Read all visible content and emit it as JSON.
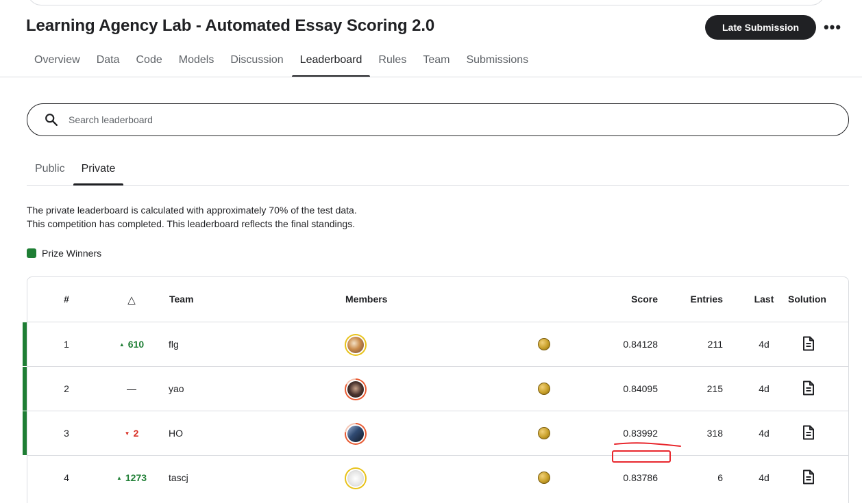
{
  "header": {
    "title": "Learning Agency Lab - Automated Essay Scoring 2.0",
    "late_submission_label": "Late Submission",
    "more_label": "•••"
  },
  "nav": {
    "tabs": [
      {
        "label": "Overview",
        "active": false
      },
      {
        "label": "Data",
        "active": false
      },
      {
        "label": "Code",
        "active": false
      },
      {
        "label": "Models",
        "active": false
      },
      {
        "label": "Discussion",
        "active": false
      },
      {
        "label": "Leaderboard",
        "active": true
      },
      {
        "label": "Rules",
        "active": false
      },
      {
        "label": "Team",
        "active": false
      },
      {
        "label": "Submissions",
        "active": false
      }
    ]
  },
  "search": {
    "placeholder": "Search leaderboard",
    "value": ""
  },
  "subtabs": [
    {
      "label": "Public",
      "active": false
    },
    {
      "label": "Private",
      "active": true
    }
  ],
  "info": {
    "line1": "The private leaderboard is calculated with approximately 70% of the test data.",
    "line2": "This competition has completed. This leaderboard reflects the final standings."
  },
  "legend": {
    "label": "Prize Winners",
    "color": "#1e7e34"
  },
  "table": {
    "headers": {
      "rank": "#",
      "delta": "△",
      "team": "Team",
      "members": "Members",
      "score": "Score",
      "entries": "Entries",
      "last": "Last",
      "solution": "Solution"
    },
    "rows": [
      {
        "rank": "1",
        "delta": "610",
        "delta_dir": "up",
        "team": "flg",
        "avatar_ring": "#e8c21a",
        "avatar_fill": "#c9a27a",
        "score": "0.84128",
        "entries": "211",
        "last": "4d",
        "prize_winner": true
      },
      {
        "rank": "2",
        "delta": "—",
        "delta_dir": "none",
        "team": "yao",
        "avatar_ring": "#e85a32",
        "avatar_fill": "#3a2c2a",
        "score": "0.84095",
        "entries": "215",
        "last": "4d",
        "prize_winner": true
      },
      {
        "rank": "3",
        "delta": "2",
        "delta_dir": "down",
        "team": "HO",
        "avatar_ring": "#e85a32",
        "avatar_fill": "#2f4a72",
        "score": "0.83992",
        "entries": "318",
        "last": "4d",
        "prize_winner": true
      },
      {
        "rank": "4",
        "delta": "1273",
        "delta_dir": "up",
        "team": "tascj",
        "avatar_ring": "#e8c21a",
        "avatar_fill": "#e9e9e9",
        "score": "0.83786",
        "entries": "6",
        "last": "4d",
        "prize_winner": false
      }
    ]
  },
  "icons": {
    "search": "search-icon",
    "medal": "gold-medal-icon",
    "solution": "document-icon",
    "more": "more-horizontal-icon"
  },
  "colors": {
    "accent_dark": "#202124",
    "winner_green": "#1e7e34",
    "delta_up": "#1e7e34",
    "delta_down": "#d93025",
    "annotation_red": "#e8262c"
  }
}
